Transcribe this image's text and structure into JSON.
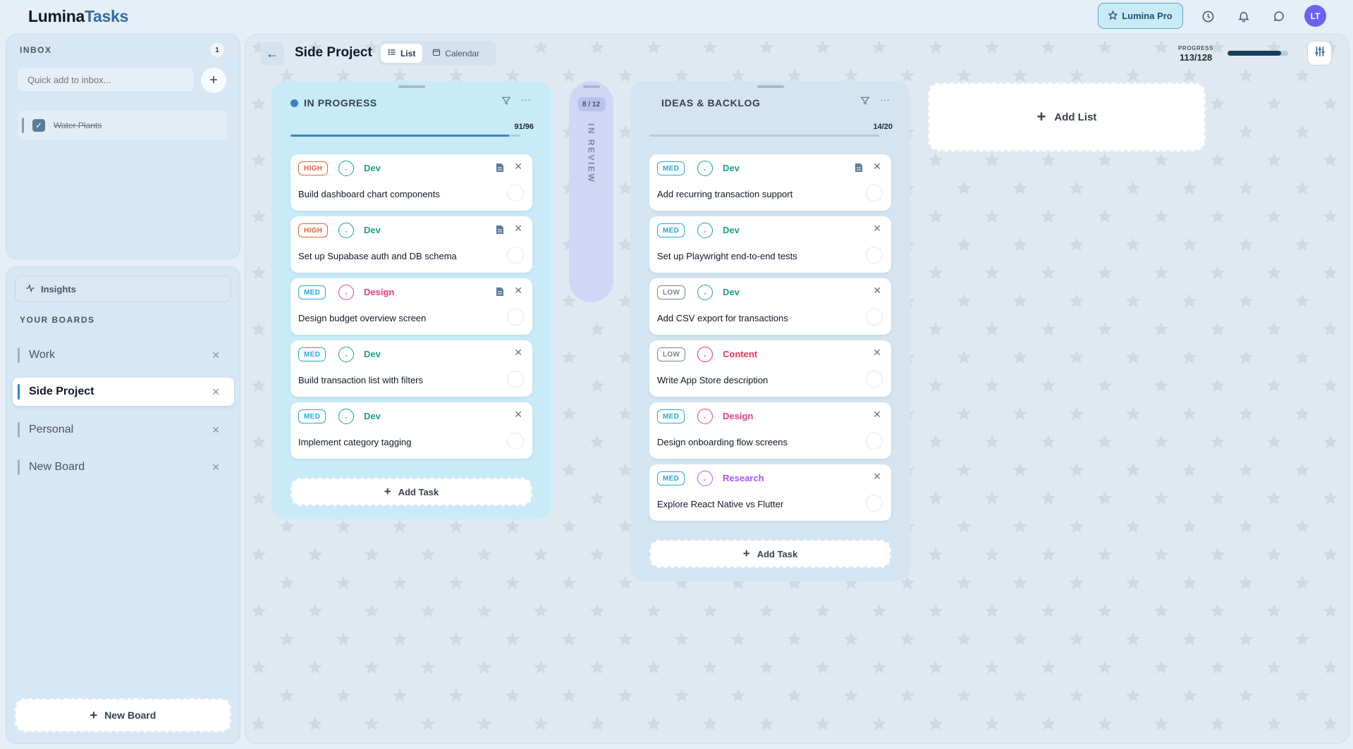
{
  "app": {
    "brand_a": "Lumina",
    "brand_b": "Tasks"
  },
  "header": {
    "pro_label": "Lumina Pro",
    "avatar_initials": "LT"
  },
  "inbox": {
    "title": "INBOX",
    "count": "1",
    "quick_add_placeholder": "Quick add to inbox...",
    "items": [
      {
        "label": "Water Plants",
        "done": true
      }
    ]
  },
  "sidebar": {
    "insights_label": "Insights",
    "boards_title": "YOUR BOARDS",
    "boards": [
      {
        "label": "Work"
      },
      {
        "label": "Side Project",
        "active": true
      },
      {
        "label": "Personal"
      },
      {
        "label": "New Board"
      }
    ],
    "new_board_label": "New Board"
  },
  "board": {
    "title": "Side Project",
    "views": [
      {
        "label": "List",
        "active": true
      },
      {
        "label": "Calendar"
      }
    ],
    "progress_label": "PROGRESS",
    "progress_value": "113/128",
    "progress_fraction": 0.883
  },
  "columns": {
    "in_progress": {
      "title": "IN PROGRESS",
      "count": "91/96",
      "add_task_label": "Add Task",
      "cards": [
        {
          "priority": "HIGH",
          "tag": "Dev",
          "title": "Build dashboard chart components",
          "has_doc": true
        },
        {
          "priority": "HIGH",
          "tag": "Dev",
          "title": "Set up Supabase auth and DB schema",
          "has_doc": true
        },
        {
          "priority": "MED",
          "tag": "Design",
          "title": "Design budget overview screen",
          "has_doc": true
        },
        {
          "priority": "MED",
          "tag": "Dev",
          "title": "Build transaction list with filters",
          "has_doc": false
        },
        {
          "priority": "MED",
          "tag": "Dev",
          "title": "Implement category tagging",
          "has_doc": false
        }
      ]
    },
    "in_review": {
      "title": "IN REVIEW",
      "count": "8 / 12"
    },
    "ideas": {
      "title": "IDEAS & BACKLOG",
      "count": "14/20",
      "add_task_label": "Add Task",
      "cards": [
        {
          "priority": "MED",
          "tag": "Dev",
          "title": "Add recurring transaction support",
          "has_doc": true
        },
        {
          "priority": "MED",
          "tag": "Dev",
          "title": "Set up Playwright end-to-end tests",
          "has_doc": false
        },
        {
          "priority": "LOW",
          "tag": "Dev",
          "title": "Add CSV export for transactions",
          "has_doc": false
        },
        {
          "priority": "LOW",
          "tag": "Content",
          "title": "Write App Store description",
          "has_doc": false
        },
        {
          "priority": "MED",
          "tag": "Design",
          "title": "Design onboarding flow screens",
          "has_doc": false
        },
        {
          "priority": "MED",
          "tag": "Research",
          "title": "Explore React Native vs Flutter",
          "has_doc": false
        }
      ]
    }
  },
  "add_list_label": "Add List",
  "colors": {
    "accent": "#2e6ea6",
    "high": "#e0643a",
    "med": "#29a8d6",
    "low": "#7a8694",
    "dev": "#1aa384",
    "design": "#e23f85",
    "content": "#e3335a",
    "research": "#a855f7",
    "avatar": "#6c63f5"
  },
  "icons": {
    "pro": "star-icon",
    "history": "clock-icon",
    "notifications": "bell-icon",
    "messages": "chat-icon",
    "back": "arrow-left-icon",
    "list_view": "list-icon",
    "calendar_view": "calendar-icon",
    "settings": "sliders-icon",
    "filter": "filter-icon",
    "more": "ellipsis-icon",
    "doc": "document-icon",
    "close": "close-icon",
    "add": "plus-icon",
    "insights": "activity-icon"
  }
}
